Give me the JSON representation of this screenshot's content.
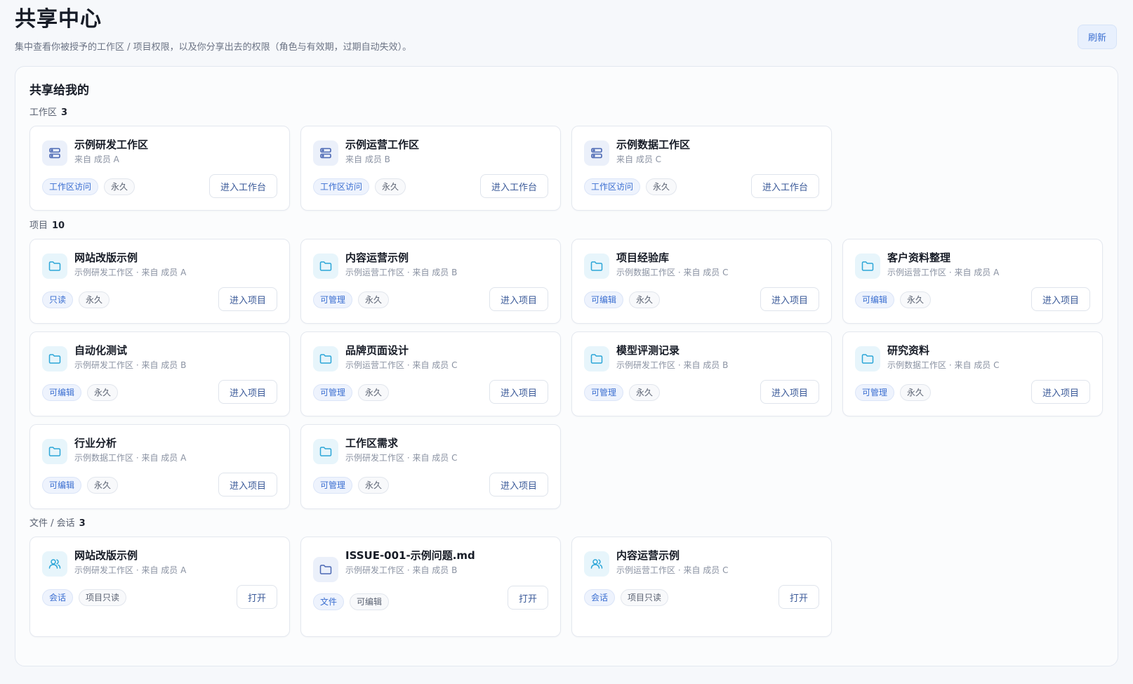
{
  "header": {
    "title": "共享中心",
    "subtitle": "集中查看你被授予的工作区 / 项目权限，以及你分享出去的权限（角色与有效期，过期自动失效）。",
    "refresh_label": "刷新"
  },
  "panel": {
    "title": "共享给我的",
    "groups": {
      "workspaces": {
        "label": "工作区",
        "count": "3",
        "items": [
          {
            "name": "示例研发工作区",
            "meta": "来自 成员 A",
            "tag1": "工作区访问",
            "tag2": "永久",
            "action": "进入工作台"
          },
          {
            "name": "示例运营工作区",
            "meta": "来自 成员 B",
            "tag1": "工作区访问",
            "tag2": "永久",
            "action": "进入工作台"
          },
          {
            "name": "示例数据工作区",
            "meta": "来自 成员 C",
            "tag1": "工作区访问",
            "tag2": "永久",
            "action": "进入工作台"
          }
        ]
      },
      "projects": {
        "label": "项目",
        "count": "10",
        "items": [
          {
            "name": "网站改版示例",
            "meta": "示例研发工作区 · 来自 成员 A",
            "tag1": "只读",
            "tag2": "永久",
            "action": "进入项目"
          },
          {
            "name": "内容运营示例",
            "meta": "示例运营工作区 · 来自 成员 B",
            "tag1": "可管理",
            "tag2": "永久",
            "action": "进入项目"
          },
          {
            "name": "项目经验库",
            "meta": "示例数据工作区 · 来自 成员 C",
            "tag1": "可编辑",
            "tag2": "永久",
            "action": "进入项目"
          },
          {
            "name": "客户资料整理",
            "meta": "示例运营工作区 · 来自 成员 A",
            "tag1": "可编辑",
            "tag2": "永久",
            "action": "进入项目"
          },
          {
            "name": "自动化测试",
            "meta": "示例研发工作区 · 来自 成员 B",
            "tag1": "可编辑",
            "tag2": "永久",
            "action": "进入项目"
          },
          {
            "name": "品牌页面设计",
            "meta": "示例运营工作区 · 来自 成员 C",
            "tag1": "可管理",
            "tag2": "永久",
            "action": "进入项目"
          },
          {
            "name": "模型评测记录",
            "meta": "示例研发工作区 · 来自 成员 B",
            "tag1": "可管理",
            "tag2": "永久",
            "action": "进入项目"
          },
          {
            "name": "研究资料",
            "meta": "示例数据工作区 · 来自 成员 C",
            "tag1": "可管理",
            "tag2": "永久",
            "action": "进入项目"
          },
          {
            "name": "行业分析",
            "meta": "示例数据工作区 · 来自 成员 A",
            "tag1": "可编辑",
            "tag2": "永久",
            "action": "进入项目"
          },
          {
            "name": "工作区需求",
            "meta": "示例研发工作区 · 来自 成员 C",
            "tag1": "可管理",
            "tag2": "永久",
            "action": "进入项目"
          }
        ]
      },
      "files": {
        "label": "文件 / 会话",
        "count": "3",
        "items": [
          {
            "icon": "people-icon",
            "name": "网站改版示例",
            "meta": "示例研发工作区 · 来自 成员 A",
            "tag1": "会话",
            "tag2": "项目只读",
            "action": "打开"
          },
          {
            "icon": "folder-icon",
            "name": "ISSUE-001-示例问题.md",
            "meta": "示例研发工作区 · 来自 成员 B",
            "tag1": "文件",
            "tag2": "可编辑",
            "action": "打开"
          },
          {
            "icon": "people-icon",
            "name": "内容运营示例",
            "meta": "示例运营工作区 · 来自 成员 C",
            "tag1": "会话",
            "tag2": "项目只读",
            "action": "打开"
          }
        ]
      }
    }
  },
  "colors": {
    "accent": "#3b6fd1",
    "folder_icon": "#2ca6d8",
    "workspace_icon": "#4a67b3"
  }
}
